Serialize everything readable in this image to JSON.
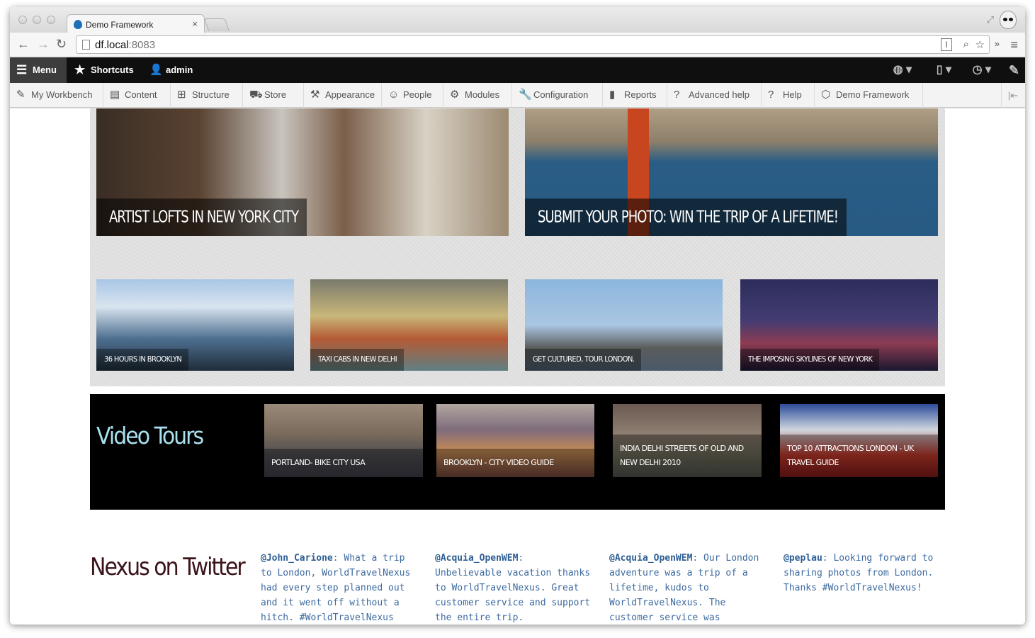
{
  "browser": {
    "tab_title": "Demo Framework",
    "tab_close": "×",
    "url_host": "df.local",
    "url_port": ":8083",
    "icons": [
      "back-icon",
      "forward-icon",
      "reload-icon",
      "page-icon",
      "reader-icon",
      "search-icon",
      "star-icon",
      "chrome-menu-icon"
    ],
    "nav_back": "←",
    "nav_forward": "→",
    "nav_reload": "↻",
    "reader": "I",
    "search": "⌕",
    "star": "☆",
    "ext": "»",
    "menu": "≡",
    "fullscreen": "⤢"
  },
  "toolbar": {
    "menu_label": "Menu",
    "shortcuts_label": "Shortcuts",
    "user_label": "admin",
    "menu_glyph": "☰",
    "star_glyph": "★",
    "user_glyph": "👤",
    "globe_glyph": "◍ ▾",
    "device_glyph": "▯ ▾",
    "history_glyph": "◷ ▾",
    "pencil_glyph": "✎"
  },
  "tray": {
    "items": [
      {
        "label": "My Workbench",
        "glyph": "✎"
      },
      {
        "label": "Content",
        "glyph": "▤"
      },
      {
        "label": "Structure",
        "glyph": "⊞"
      },
      {
        "label": "Store",
        "glyph": "⛟"
      },
      {
        "label": "Appearance",
        "glyph": "⚒"
      },
      {
        "label": "People",
        "glyph": "☺"
      },
      {
        "label": "Modules",
        "glyph": "⚙"
      },
      {
        "label": "Configuration",
        "glyph": "🔧"
      },
      {
        "label": "Reports",
        "glyph": "▮"
      },
      {
        "label": "Advanced help",
        "glyph": "?"
      },
      {
        "label": "Help",
        "glyph": "?"
      },
      {
        "label": "Demo Framework",
        "glyph": "⬡"
      }
    ],
    "collapse_glyph": "|⇤"
  },
  "featured": {
    "heroes": [
      {
        "caption": "ARTIST LOFTS IN NEW YORK CITY"
      },
      {
        "caption": "SUBMIT YOUR PHOTO: WIN THE TRIP OF A LIFETIME!"
      }
    ],
    "small": [
      {
        "caption": "36 HOURS IN BROOKLYN"
      },
      {
        "caption": "TAXI CABS IN NEW DELHI"
      },
      {
        "caption": "GET CULTURED, TOUR LONDON."
      },
      {
        "caption": "THE IMPOSING SKYLINES OF NEW YORK"
      }
    ]
  },
  "video_tours": {
    "title": "Video Tours",
    "items": [
      {
        "caption": "PORTLAND- BIKE CITY USA"
      },
      {
        "caption": "BROOKLYN - CITY VIDEO GUIDE"
      },
      {
        "caption": "INDIA DELHI STREETS OF OLD AND NEW DELHI 2010"
      },
      {
        "caption": "TOP 10 ATTRACTIONS LONDON - UK TRAVEL GUIDE"
      }
    ]
  },
  "twitter": {
    "title": "Nexus on Twitter",
    "tweets": [
      {
        "handle": "@John_Carione",
        "text": ": What a trip to London, WorldTravelNexus had every step planned out and it went off without a hitch. #WorldTravelNexus"
      },
      {
        "handle": "@Acquia_OpenWEM",
        "text": ": Unbelievable vacation thanks to WorldTravelNexus. Great customer service and support the entire trip. #WorldTravelNexus"
      },
      {
        "handle": "@Acquia_OpenWEM",
        "text": ": Our London adventure was a trip of a lifetime, kudos to WorldTravelNexus. The customer service was phenomenal. #WorldTravelNexus"
      },
      {
        "handle": "@peplau",
        "text": ": Looking forward to sharing photos from London. Thanks #WorldTravelNexus!"
      }
    ]
  }
}
